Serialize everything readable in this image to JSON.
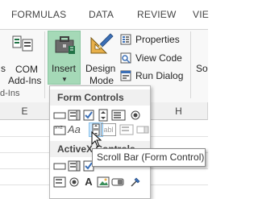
{
  "tabs": [
    "FORMULAS",
    "DATA",
    "REVIEW",
    "VIE"
  ],
  "ribbon": {
    "left_button_partial": "s",
    "com_addins_line1": "COM",
    "com_addins_line2": "Add-Ins",
    "insert_label": "Insert",
    "design_mode_line1": "Design",
    "design_mode_line2": "Mode",
    "properties_label": "Properties",
    "view_code_label": "View Code",
    "run_dialog_label": "Run Dialog",
    "right_partial": "So",
    "group_label_partial": "d-Ins"
  },
  "columns": [
    "E",
    "",
    "H"
  ],
  "dropdown": {
    "form_controls_header": "Form Controls",
    "activex_controls_header": "ActiveX Controls",
    "form_controls_row2_text": "Aa",
    "form_controls_row2_textfield": "abl",
    "activex_row2_text": "A"
  },
  "tooltip": "Scroll Bar (Form Control)",
  "colors": {
    "insert_highlight": "#a5d9b7",
    "ribbon_bg": "#f8f8f8",
    "selected_control": "#cde8ff",
    "excel_green": "#217346"
  }
}
